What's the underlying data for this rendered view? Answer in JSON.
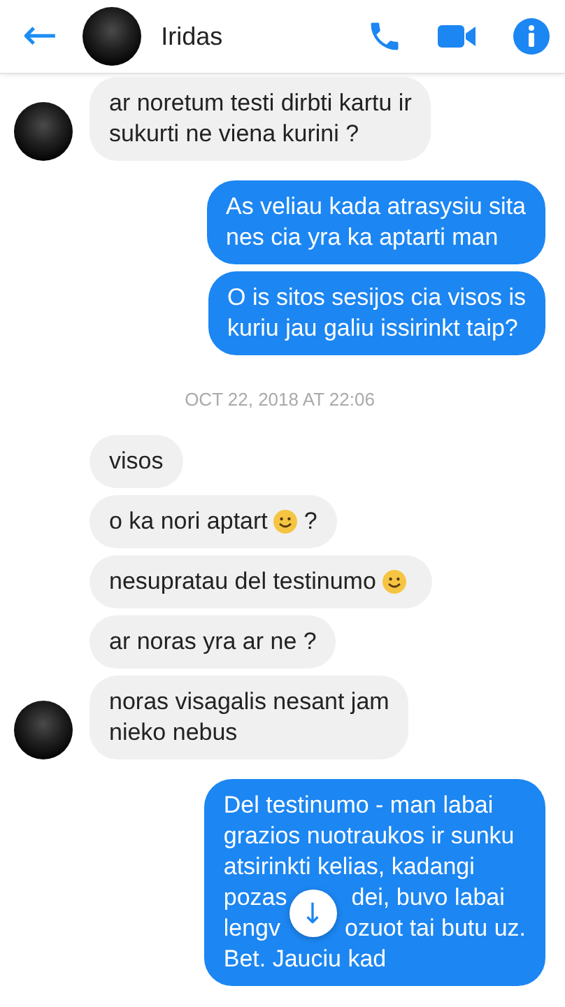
{
  "header": {
    "back": "←",
    "name": "Iridas"
  },
  "thread": [
    {
      "kind": "incoming",
      "messages": [
        {
          "lines": [
            [
              "ar noretum testi dirbti kartu ir"
            ],
            [
              "sukurti ne viena kurini ?"
            ]
          ]
        }
      ]
    },
    {
      "kind": "outgoing",
      "messages": [
        {
          "lines": [
            [
              "As veliau kada atrasysiu sita"
            ],
            [
              "nes cia yra ka aptarti man"
            ]
          ]
        },
        {
          "lines": [
            [
              "O is sitos sesijos cia visos is"
            ],
            [
              "kuriu jau galiu issirinkt taip?"
            ]
          ]
        }
      ]
    },
    {
      "kind": "timestamp",
      "text": "OCT 22, 2018 AT 22:06"
    },
    {
      "kind": "incoming",
      "messages": [
        {
          "lines": [
            [
              "visos"
            ]
          ]
        },
        {
          "lines": [
            [
              "o ka nori aptart"
            ]
          ],
          "emoji": true,
          "after": "?"
        },
        {
          "lines": [
            [
              "nesupratau del testinumo"
            ]
          ],
          "emoji": true
        },
        {
          "lines": [
            [
              "ar noras yra ar ne ?"
            ]
          ]
        },
        {
          "lines": [
            [
              "noras visagalis nesant jam"
            ],
            [
              "nieko nebus"
            ]
          ]
        }
      ]
    },
    {
      "kind": "outgoing",
      "messages": [
        {
          "lines": [
            [
              "Del testinumo - man labai"
            ],
            [
              "grazios nuotraukos ir sunku"
            ],
            [
              "atsirinkti kelias, kadangi"
            ],
            [
              "pozas",
              "dei, buvo labai"
            ],
            [
              "lengv",
              "ozuot tai butu uz."
            ],
            [
              "Bet. Jauciu kad"
            ]
          ]
        }
      ]
    }
  ],
  "scroll_down": "↓"
}
